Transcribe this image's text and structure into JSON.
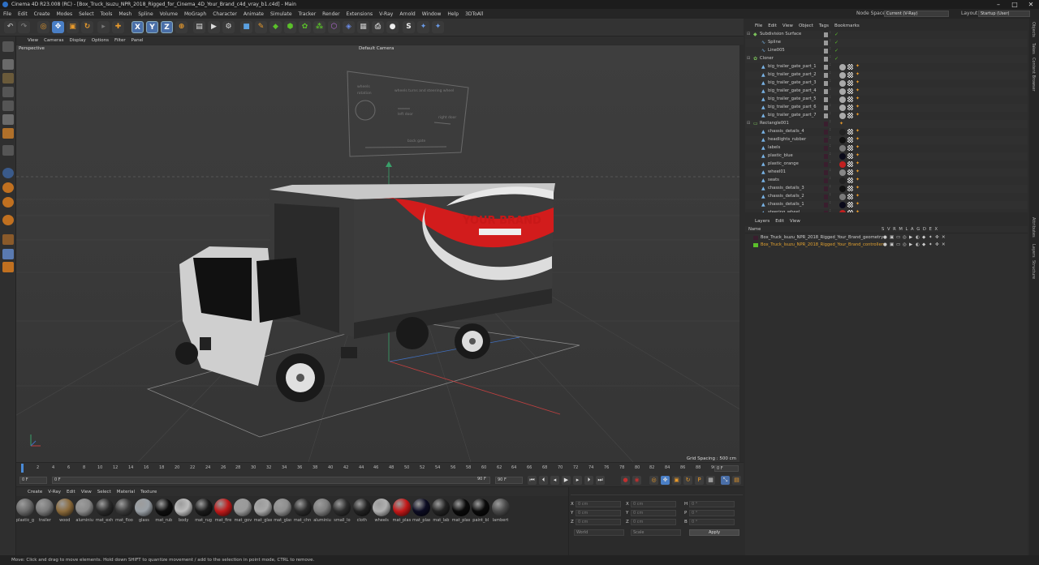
{
  "window": {
    "title": "Cinema 4D R23.008 (RC) - [Box_Truck_Isuzu_NPR_2018_Rigged_for_Cinema_4D_Your_Brand_c4d_vray_b1.c4d] - Main"
  },
  "menubar": [
    "File",
    "Edit",
    "Create",
    "Modes",
    "Select",
    "Tools",
    "Mesh",
    "Spline",
    "Volume",
    "MoGraph",
    "Character",
    "Animate",
    "Simulate",
    "Tracker",
    "Render",
    "Extensions",
    "V-Ray",
    "Arnold",
    "Window",
    "Help",
    "3DToAll"
  ],
  "nodespace": {
    "label": "Node Space:",
    "value": "Current (V-Ray)"
  },
  "layout": {
    "label": "Layout:",
    "value": "Startup (User)"
  },
  "toolbar": {
    "axis_x": "X",
    "axis_y": "Y",
    "axis_z": "Z"
  },
  "viewport": {
    "menu": [
      "View",
      "Cameras",
      "Display",
      "Options",
      "Filter",
      "Panel"
    ],
    "name": "Perspective",
    "camera": "Default Camera",
    "grid_spacing": "Grid Spacing : 500 cm",
    "brand_text": "YOUR BRAND",
    "panel": {
      "wheels": "wheels",
      "rotation": "rotation",
      "wheels_turns": "wheels turns and steering wheel",
      "left_door": "left door",
      "right_door": "right door",
      "back_gate": "back gate"
    }
  },
  "timeline": {
    "ticks": [
      "0",
      "2",
      "4",
      "6",
      "8",
      "10",
      "12",
      "14",
      "16",
      "18",
      "20",
      "22",
      "24",
      "26",
      "28",
      "30",
      "32",
      "34",
      "36",
      "38",
      "40",
      "42",
      "44",
      "46",
      "48",
      "50",
      "52",
      "54",
      "56",
      "58",
      "60",
      "62",
      "64",
      "66",
      "68",
      "70",
      "72",
      "74",
      "76",
      "78",
      "80",
      "82",
      "84",
      "86",
      "88",
      "90"
    ],
    "end_frame": "0 F"
  },
  "transport": {
    "current": "0 F",
    "start": "0 F",
    "end": "90 F",
    "end2": "90 F"
  },
  "materials": {
    "menu": [
      "Create",
      "V-Ray",
      "Edit",
      "View",
      "Select",
      "Material",
      "Texture"
    ],
    "items": [
      {
        "name": "plastic_g",
        "color": "#6a6a6a"
      },
      {
        "name": "trailer",
        "color": "#7a7a7a"
      },
      {
        "name": "wood",
        "color": "#8b6a3a"
      },
      {
        "name": "aluminiu",
        "color": "#8a8a8a"
      },
      {
        "name": "mat_exh",
        "color": "#2a2a2a"
      },
      {
        "name": "mat_floo",
        "color": "#3a3a3a"
      },
      {
        "name": "glass",
        "color": "#9aa0a6"
      },
      {
        "name": "mat_rub",
        "color": "#0e0e0e"
      },
      {
        "name": "body",
        "color": "#bcbcbc"
      },
      {
        "name": "mat_rug",
        "color": "#1a1a1a"
      },
      {
        "name": "mat_fire",
        "color": "#c01a1a"
      },
      {
        "name": "mat_gov",
        "color": "#9a9a9a"
      },
      {
        "name": "mat_glas",
        "color": "#a8a8a8"
      },
      {
        "name": "mat_glas",
        "color": "#8e8e8e"
      },
      {
        "name": "mat_chn",
        "color": "#2a2a2a"
      },
      {
        "name": "aluminiu",
        "color": "#7e7e7e"
      },
      {
        "name": "small_lo",
        "color": "#2c2c2c"
      },
      {
        "name": "cloth",
        "color": "#222222"
      },
      {
        "name": "wheels",
        "color": "#b0b0b0"
      },
      {
        "name": "mat_plas",
        "color": "#c41818"
      },
      {
        "name": "mat_plas",
        "color": "#0c0c22"
      },
      {
        "name": "mat_lab",
        "color": "#222222"
      },
      {
        "name": "mat_plas",
        "color": "#0a0a0a"
      },
      {
        "name": "paint_bl",
        "color": "#0a0a0a"
      },
      {
        "name": "lambert",
        "color": "#4a4a4a"
      }
    ]
  },
  "coords": {
    "rows": [
      {
        "a": "X",
        "av": "0 cm",
        "b": "X",
        "bv": "0 cm",
        "c": "H",
        "cv": "0 °"
      },
      {
        "a": "Y",
        "av": "0 cm",
        "b": "Y",
        "bv": "0 cm",
        "c": "P",
        "cv": "0 °"
      },
      {
        "a": "Z",
        "av": "0 cm",
        "b": "Z",
        "bv": "0 cm",
        "c": "B",
        "cv": "0 °"
      }
    ],
    "mode1": "World",
    "mode2": "Scale",
    "apply": "Apply"
  },
  "objects": {
    "menu": [
      "File",
      "Edit",
      "View",
      "Object",
      "Tags",
      "Bookmarks"
    ],
    "items": [
      {
        "name": "Subdivision Surface",
        "indent": 0,
        "icon": "◆"
      },
      {
        "name": "Spline",
        "indent": 1,
        "icon": "∿"
      },
      {
        "name": "Line005",
        "indent": 1,
        "icon": "∿"
      },
      {
        "name": "Cloner",
        "indent": 0,
        "icon": "✿"
      },
      {
        "name": "big_trailer_gate_part_1",
        "indent": 1,
        "icon": "▲"
      },
      {
        "name": "big_trailer_gate_part_2",
        "indent": 1,
        "icon": "▲"
      },
      {
        "name": "big_trailer_gate_part_3",
        "indent": 1,
        "icon": "▲"
      },
      {
        "name": "big_trailer_gate_part_4",
        "indent": 1,
        "icon": "▲"
      },
      {
        "name": "big_trailer_gate_part_5",
        "indent": 1,
        "icon": "▲"
      },
      {
        "name": "big_trailer_gate_part_6",
        "indent": 1,
        "icon": "▲"
      },
      {
        "name": "big_trailer_gate_part_7",
        "indent": 1,
        "icon": "▲"
      },
      {
        "name": "Rectangle001",
        "indent": 0,
        "icon": "▭"
      },
      {
        "name": "chassis_details_4",
        "indent": 1,
        "icon": "▲"
      },
      {
        "name": "headlights_rubber",
        "indent": 1,
        "icon": "▲"
      },
      {
        "name": "labels",
        "indent": 1,
        "icon": "▲"
      },
      {
        "name": "plastic_blue",
        "indent": 1,
        "icon": "▲"
      },
      {
        "name": "plastic_orange",
        "indent": 1,
        "icon": "▲"
      },
      {
        "name": "wheel01",
        "indent": 1,
        "icon": "▲"
      },
      {
        "name": "seats",
        "indent": 1,
        "icon": "▲"
      },
      {
        "name": "chassis_details_3",
        "indent": 1,
        "icon": "▲"
      },
      {
        "name": "chassis_details_2",
        "indent": 1,
        "icon": "▲"
      },
      {
        "name": "chassis_details_1",
        "indent": 1,
        "icon": "▲"
      },
      {
        "name": "steering_wheel",
        "indent": 1,
        "icon": "▲"
      }
    ]
  },
  "layers": {
    "menu": [
      "Layers",
      "Edit",
      "View"
    ],
    "header": "Name",
    "flags": "S V R M L A G D E X",
    "items": [
      {
        "name": "Box_Truck_Isuzu_NPR_2018_Rigged_Your_Brand_geometry",
        "color": "#d0d0d0",
        "swatch": "#3a1e2e"
      },
      {
        "name": "Box_Truck_Isuzu_NPR_2018_Rigged_Your_Brand_controllers",
        "color": "#e0a030",
        "swatch": "#5ac02a"
      }
    ]
  },
  "right_tabs": [
    "Objects",
    "Takes",
    "Content Browser",
    "Attributes",
    "Layers",
    "Structure"
  ],
  "status": "Move: Click and drag to move elements. Hold down SHIFT to quantize movement / add to the selection in point mode, CTRL to remove."
}
